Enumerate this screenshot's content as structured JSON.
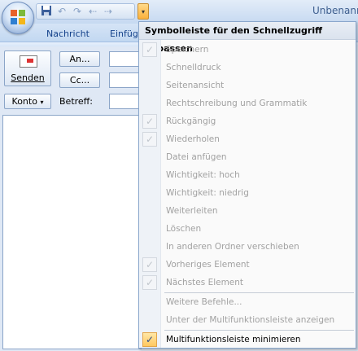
{
  "window": {
    "title": "Unbenann"
  },
  "qat": {
    "icons": [
      "save-icon",
      "undo-icon",
      "redo-icon",
      "previous-icon",
      "next-icon"
    ],
    "dropdown_glyph": "▾"
  },
  "tabs": [
    {
      "label": "Nachricht"
    },
    {
      "label": "Einfüg"
    }
  ],
  "compose": {
    "send_label": "Senden",
    "to_label": "An...",
    "cc_label": "Cc...",
    "account_label": "Konto",
    "subject_label": "Betreff:"
  },
  "menu": {
    "header": "Symbolleiste für den Schnellzugriff anpassen",
    "items": [
      {
        "label": "Speichern",
        "checked": true
      },
      {
        "label": "Schnelldruck",
        "checked": false
      },
      {
        "label": "Seitenansicht",
        "checked": false
      },
      {
        "label": "Rechtschreibung und Grammatik",
        "checked": false
      },
      {
        "label": "Rückgängig",
        "checked": true
      },
      {
        "label": "Wiederholen",
        "checked": true
      },
      {
        "label": "Datei anfügen",
        "checked": false
      },
      {
        "label": "Wichtigkeit: hoch",
        "checked": false
      },
      {
        "label": "Wichtigkeit: niedrig",
        "checked": false
      },
      {
        "label": "Weiterleiten",
        "checked": false
      },
      {
        "label": "Löschen",
        "checked": false
      },
      {
        "label": "In anderen Ordner verschieben",
        "checked": false
      },
      {
        "label": "Vorheriges Element",
        "checked": true
      },
      {
        "label": "Nächstes Element",
        "checked": true
      }
    ],
    "more_commands": "Weitere Befehle...",
    "show_below": "Unter der Multifunktionsleiste anzeigen",
    "minimize_ribbon": {
      "label": "Multifunktionsleiste minimieren",
      "checked": true
    }
  },
  "colors": {
    "accent": "#15428b",
    "highlight": "#ffc860",
    "disabled_text": "#a1a1a1"
  }
}
